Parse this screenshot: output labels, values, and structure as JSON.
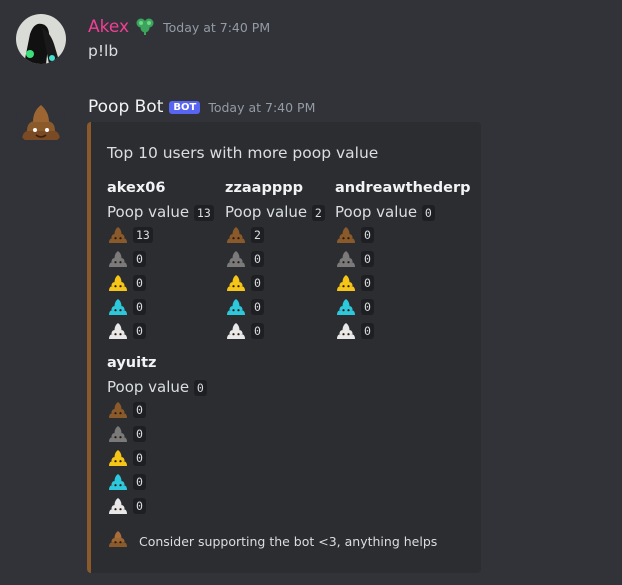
{
  "messages": [
    {
      "username": "Akex",
      "username_color": "#f23f95",
      "timestamp": "Today at 7:40 PM",
      "text": "p!lb"
    },
    {
      "username": "Poop Bot",
      "username_color": "#f2f3f5",
      "badge": "BOT",
      "timestamp": "Today at 7:40 PM"
    }
  ],
  "embed": {
    "accent_color": "#8b5a2b",
    "title": "Top 10 users with more poop value",
    "fields": [
      {
        "name": "akex06",
        "pv_label": "Poop value",
        "pv": "13",
        "counts": [
          "13",
          "0",
          "0",
          "0",
          "0"
        ]
      },
      {
        "name": "zzaapppp",
        "pv_label": "Poop value",
        "pv": "2",
        "counts": [
          "2",
          "0",
          "0",
          "0",
          "0"
        ]
      },
      {
        "name": "andreawthederp",
        "pv_label": "Poop value",
        "pv": "0",
        "counts": [
          "0",
          "0",
          "0",
          "0",
          "0"
        ]
      },
      {
        "name": "ayuitz",
        "pv_label": "Poop value",
        "pv": "0",
        "counts": [
          "0",
          "0",
          "0",
          "0",
          "0"
        ]
      }
    ],
    "poop_colors": [
      "#8b5a2b",
      "#7a7a7a",
      "#f5c518",
      "#2dc8dc",
      "#e8e8e8"
    ],
    "footer_text": "Consider supporting the bot <3, anything helps"
  }
}
